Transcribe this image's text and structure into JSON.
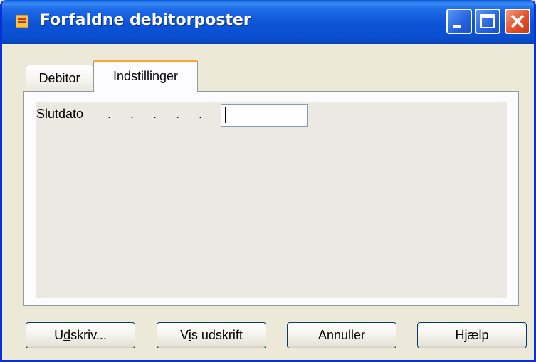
{
  "window": {
    "title": "Forfaldne debitorposter",
    "controls": [
      "minimize-icon",
      "maximize-icon",
      "close-icon"
    ]
  },
  "tabs": [
    {
      "label": "Debitor",
      "active": false
    },
    {
      "label": "Indstillinger",
      "active": true
    }
  ],
  "fields": {
    "slutdato_label": "Slutdato",
    "slutdato_dots": ". . . . . . . .",
    "slutdato_value": ""
  },
  "buttons": {
    "print": {
      "pre": "U",
      "ul": "d",
      "post": "skriv..."
    },
    "preview": {
      "pre": "V",
      "ul": "i",
      "post": "s udskrift"
    },
    "cancel": {
      "label": "Annuller"
    },
    "help": {
      "label": "Hjælp"
    }
  },
  "colors": {
    "titlebar": "#0b53d6",
    "active_tab_accent": "#f9a633",
    "close_button": "#e4512d",
    "window_bg": "#ece9d8"
  }
}
